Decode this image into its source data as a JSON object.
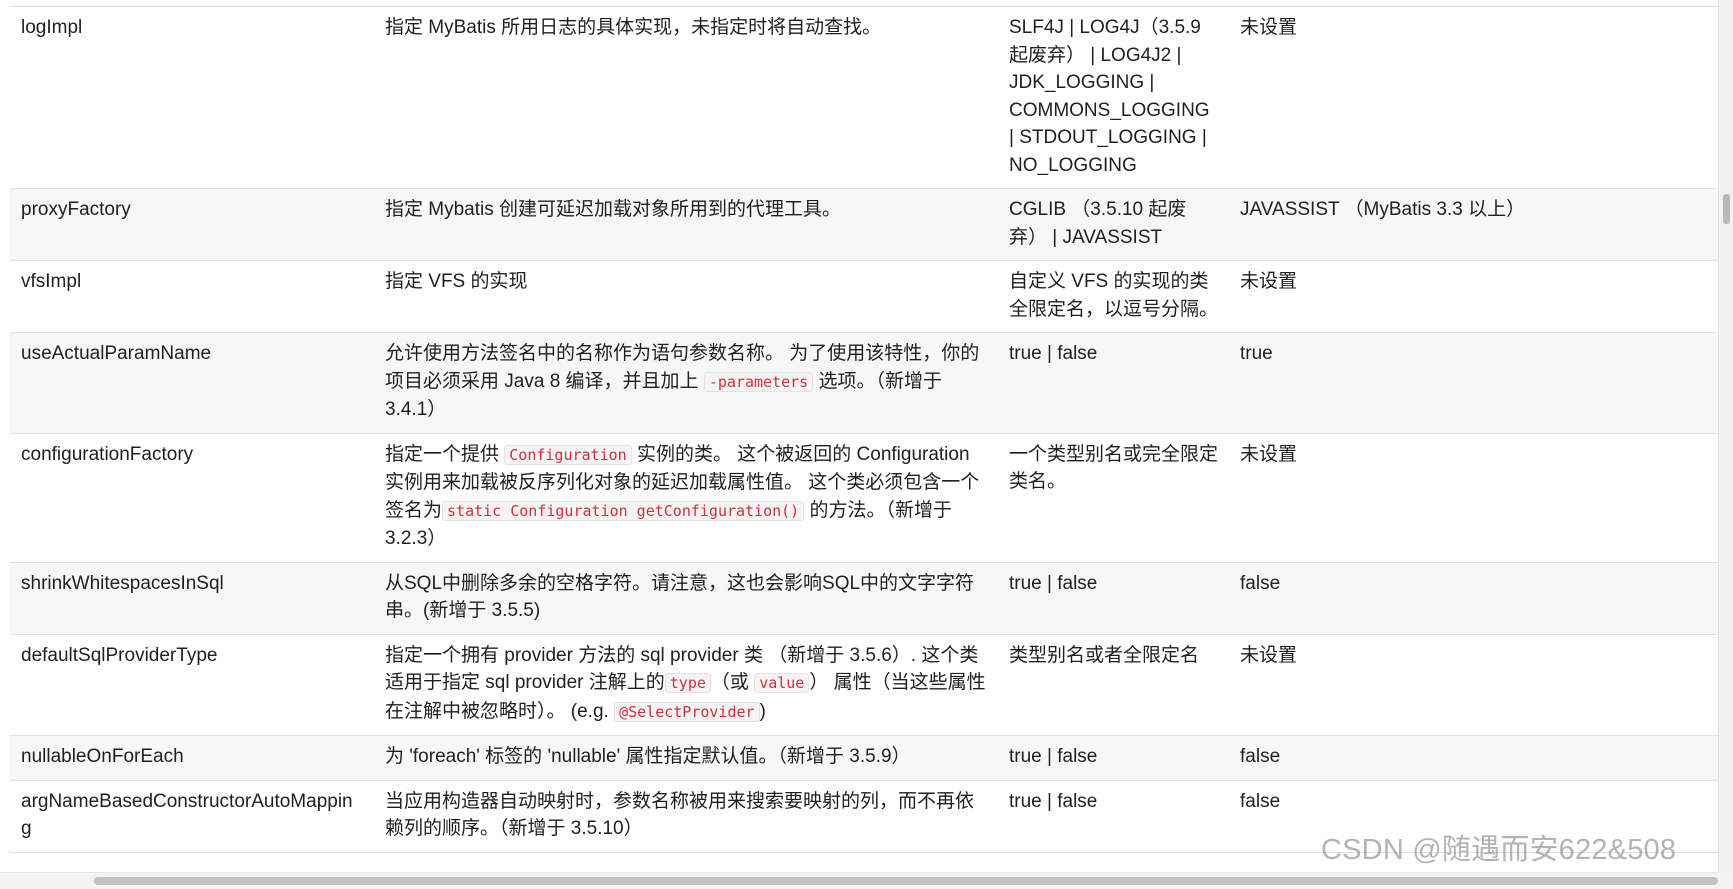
{
  "table": {
    "rows": [
      {
        "name": "logImpl",
        "description": "指定 MyBatis 所用日志的具体实现，未指定时将自动查找。",
        "values": "SLF4J | LOG4J（3.5.9 起废弃） | LOG4J2 | JDK_LOGGING | COMMONS_LOGGING | STDOUT_LOGGING | NO_LOGGING",
        "default": "未设置"
      },
      {
        "name": "proxyFactory",
        "description": "指定 Mybatis 创建可延迟加载对象所用到的代理工具。",
        "values": "CGLIB （3.5.10 起废弃） | JAVASSIST",
        "default": "JAVASSIST （MyBatis 3.3 以上）"
      },
      {
        "name": "vfsImpl",
        "description": "指定 VFS 的实现",
        "values": "自定义 VFS 的实现的类全限定名，以逗号分隔。",
        "default": "未设置"
      },
      {
        "name": "useActualParamName",
        "description_parts": {
          "before": "允许使用方法签名中的名称作为语句参数名称。 为了使用该特性，你的项目必须采用 Java 8 编译，并且加上 ",
          "code": "-parameters",
          "after": " 选项。（新增于 3.4.1）"
        },
        "values": "true | false",
        "default": "true"
      },
      {
        "name": "configurationFactory",
        "description_parts": {
          "before": "指定一个提供 ",
          "code1": "Configuration",
          "middle": " 实例的类。 这个被返回的 Configuration 实例用来加载被反序列化对象的延迟加载属性值。 这个类必须包含一个签名为",
          "code2": "static Configuration getConfiguration()",
          "after": " 的方法。（新增于 3.2.3）"
        },
        "values": "一个类型别名或完全限定类名。",
        "default": "未设置"
      },
      {
        "name": "shrinkWhitespacesInSql",
        "description": "从SQL中删除多余的空格字符。请注意，这也会影响SQL中的文字字符串。(新增于 3.5.5)",
        "values": "true | false",
        "default": "false"
      },
      {
        "name": "defaultSqlProviderType",
        "description_parts": {
          "before": "指定一个拥有 provider 方法的 sql provider 类 （新增于 3.5.6）. 这个类适用于指定 sql provider 注解上的",
          "code1": "type",
          "middle1": "（或 ",
          "code2": "value",
          "middle2": "） 属性（当这些属性在注解中被忽略时）。 (e.g. ",
          "code3": "@SelectProvider",
          "after": ")"
        },
        "values": "类型别名或者全限定名",
        "default": "未设置"
      },
      {
        "name": "nullableOnForEach",
        "description": "为 'foreach' 标签的 'nullable' 属性指定默认值。（新增于 3.5.9）",
        "values": "true | false",
        "default": "false"
      },
      {
        "name": "argNameBasedConstructorAutoMapping",
        "description": "当应用构造器自动映射时，参数名称被用来搜索要映射的列，而不再依赖列的顺序。（新增于 3.5.10）",
        "values": "true | false",
        "default": "false"
      }
    ]
  },
  "watermark": {
    "text": "CSDN @随遇而安622&508"
  },
  "colors": {
    "code_text": "#d1303d",
    "row_stripe": "#f7f7f7",
    "row_border": "#e1e1e1",
    "watermark": "#969696"
  },
  "icons": {
    "vertical_scrollbar": "vertical-scrollbar-thumb",
    "horizontal_scrollbar": "horizontal-scrollbar-thumb"
  }
}
